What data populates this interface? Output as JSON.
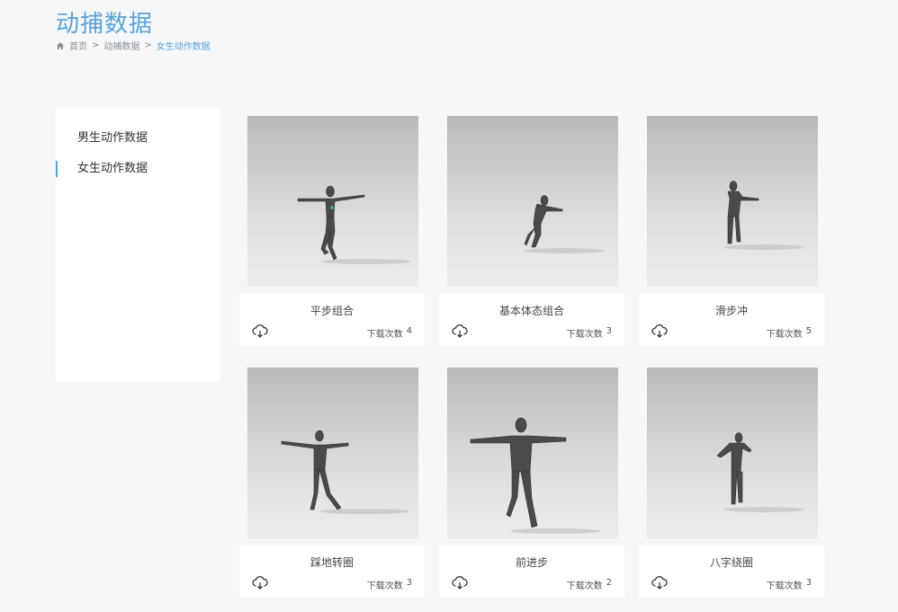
{
  "header": {
    "title": "动捕数据",
    "breadcrumb": {
      "home_icon": "home-icon",
      "items": [
        "首页",
        "动捕数据",
        "女生动作数据"
      ],
      "separator": ">"
    }
  },
  "sidebar": {
    "items": [
      {
        "label": "男生动作数据",
        "active": false
      },
      {
        "label": "女生动作数据",
        "active": true
      }
    ]
  },
  "cards": [
    {
      "name": "平步组合",
      "download_label": "下载次数",
      "downloads": "4",
      "icon": "cloud-download-icon"
    },
    {
      "name": "基本体态组合",
      "download_label": "下载次数",
      "downloads": "3",
      "icon": "cloud-download-icon"
    },
    {
      "name": "滑步冲",
      "download_label": "下载次数",
      "downloads": "5",
      "icon": "cloud-download-icon"
    },
    {
      "name": "踩地转圈",
      "download_label": "下载次数",
      "downloads": "3",
      "icon": "cloud-download-icon"
    },
    {
      "name": "前进步",
      "download_label": "下载次数",
      "downloads": "2",
      "icon": "cloud-download-icon"
    },
    {
      "name": "八字绕圈",
      "download_label": "下载次数",
      "downloads": "3",
      "icon": "cloud-download-icon"
    }
  ],
  "colors": {
    "accent": "#5aa3d8",
    "background": "#f5f7f9",
    "card": "#ffffff"
  }
}
